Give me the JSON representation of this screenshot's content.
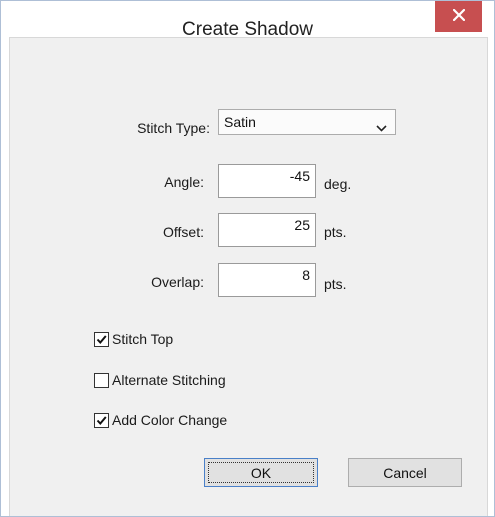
{
  "window": {
    "title": "Create Shadow"
  },
  "icons": {
    "close": "close-icon",
    "dropdown": "chevron-down-icon",
    "check": "check-icon"
  },
  "colors": {
    "close_button": "#c74f50",
    "dialog_background": "#f0f0f0",
    "default_button_border": "#4a80c8"
  },
  "form": {
    "stitch_type": {
      "label": "Stitch Type:",
      "value": "Satin"
    },
    "angle": {
      "label": "Angle:",
      "value": "-45",
      "unit": "deg."
    },
    "offset": {
      "label": "Offset:",
      "value": "25",
      "unit": "pts."
    },
    "overlap": {
      "label": "Overlap:",
      "value": "8",
      "unit": "pts."
    }
  },
  "checkboxes": [
    {
      "label": "Stitch Top",
      "checked": true
    },
    {
      "label": "Alternate Stitching",
      "checked": false
    },
    {
      "label": "Add Color Change",
      "checked": true
    }
  ],
  "buttons": {
    "ok": "OK",
    "cancel": "Cancel"
  }
}
